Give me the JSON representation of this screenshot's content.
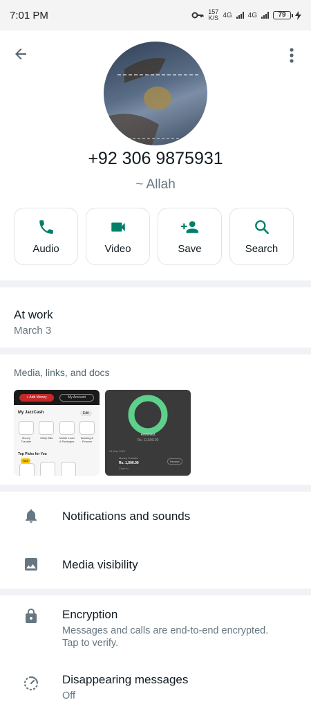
{
  "status_bar": {
    "time": "7:01 PM",
    "speed_value": "157",
    "speed_unit": "K/S",
    "network_1": "4G",
    "network_2": "4G",
    "battery": "79"
  },
  "contact": {
    "phone": "+92 306 9875931",
    "about": "~ Allah"
  },
  "actions": [
    {
      "label": "Audio",
      "icon": "phone-icon"
    },
    {
      "label": "Video",
      "icon": "video-camera-icon"
    },
    {
      "label": "Save",
      "icon": "add-person-icon"
    },
    {
      "label": "Search",
      "icon": "search-icon"
    }
  ],
  "status": {
    "text": "At work",
    "date": "March 3"
  },
  "media": {
    "title": "Media, links, and docs",
    "thumb1": {
      "add_money": "+ Add Money",
      "my_account": "My Account",
      "heading": "My JazzCash",
      "edit": "Edit",
      "items": [
        "Money Transfer",
        "Utility Bills",
        "Mobile Load & Packages",
        "Banking & Finance"
      ],
      "top_picks": "Top Picks for You",
      "new_badge": "New"
    },
    "thumb2": {
      "received": "Received",
      "amount_top": "Rs. 11,500.00",
      "date": "24 May 2024",
      "transfer": "Money Transfer",
      "amount": "Rs. 1,500.00",
      "receipt": "Receipt",
      "sub": "Cash In"
    }
  },
  "settings": {
    "notifications": "Notifications and sounds",
    "media_visibility": "Media visibility",
    "encryption": "Encryption",
    "encryption_desc": "Messages and calls are end-to-end encrypted. Tap to verify.",
    "disappearing": "Disappearing messages",
    "disappearing_value": "Off"
  },
  "colors": {
    "accent": "#008069",
    "divider": "#f0f2f5"
  }
}
